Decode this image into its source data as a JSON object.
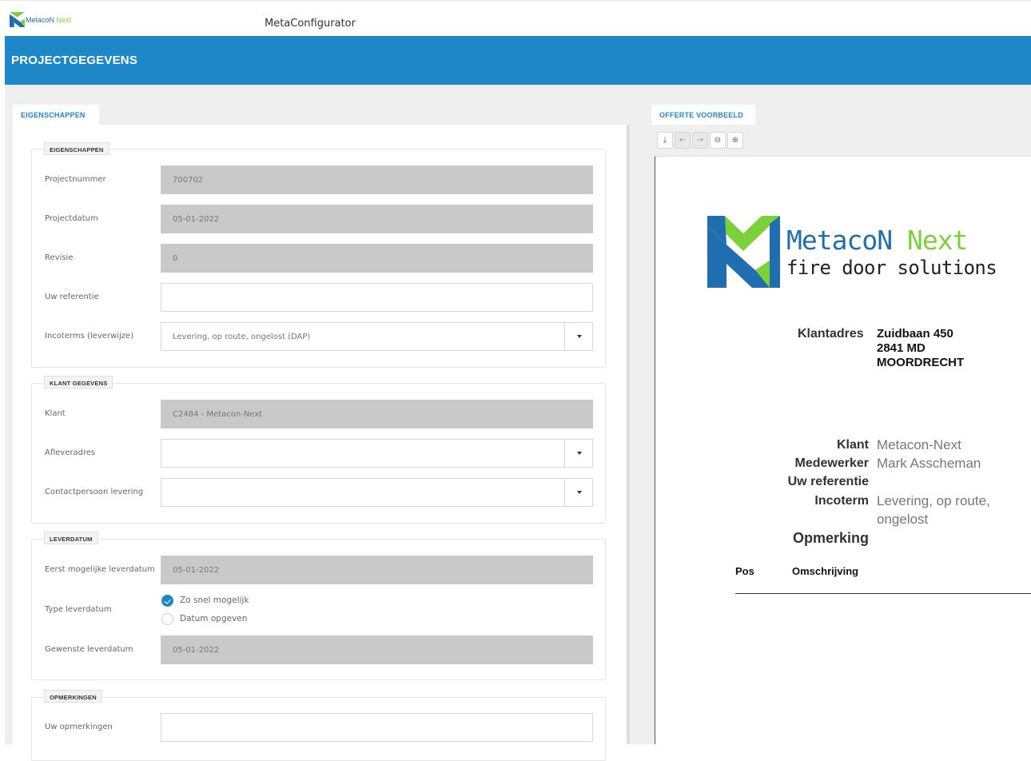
{
  "topbar": {
    "logo_word1": "MetacoN",
    "logo_word2": "Next",
    "app_title": "MetaConfigurator"
  },
  "header": {
    "title": "PROJECTGEGEVENS"
  },
  "tabs": {
    "left": "EIGENSCHAPPEN",
    "right": "OFFERTE VOORBEELD"
  },
  "sections": {
    "eigenschappen": {
      "legend": "EIGENSCHAPPEN",
      "fields": {
        "projectnummer": {
          "label": "Projectnummer",
          "value": "700702"
        },
        "projectdatum": {
          "label": "Projectdatum",
          "value": "05-01-2022"
        },
        "revisie": {
          "label": "Revisie",
          "value": "0"
        },
        "uw_referentie": {
          "label": "Uw referentie",
          "value": ""
        },
        "incoterms": {
          "label": "Incoterms (leverwijze)",
          "value": "Levering, op route, ongelost (DAP)"
        }
      }
    },
    "klant": {
      "legend": "KLANT GEGEVENS",
      "fields": {
        "klant": {
          "label": "Klant",
          "value": "C2484 - Metacon-Next"
        },
        "afleveradres": {
          "label": "Afleveradres",
          "value": ""
        },
        "contactpersoon": {
          "label": "Contactpersoon levering",
          "value": ""
        }
      }
    },
    "leverdatum": {
      "legend": "LEVERDATUM",
      "fields": {
        "eerst_mogelijk": {
          "label": "Eerst mogelijke leverdatum",
          "value": "05-01-2022"
        },
        "type": {
          "label": "Type leverdatum",
          "options": [
            "Zo snel mogelijk",
            "Datum opgeven"
          ],
          "selected": "Zo snel mogelijk"
        },
        "gewenst": {
          "label": "Gewenste leverdatum",
          "value": "05-01-2022"
        }
      }
    },
    "opmerkingen": {
      "legend": "OPMERKINGEN",
      "fields": {
        "uw_opmerkingen": {
          "label": "Uw opmerkingen",
          "value": ""
        }
      }
    }
  },
  "toolbar": {
    "buttons": [
      {
        "name": "download-icon",
        "glyph": "⤓",
        "enabled": true
      },
      {
        "name": "arrow-left-icon",
        "glyph": "←",
        "enabled": false
      },
      {
        "name": "arrow-right-icon",
        "glyph": "→",
        "enabled": false
      },
      {
        "name": "zoom-out-icon",
        "glyph": "⊖",
        "enabled": true
      },
      {
        "name": "zoom-in-icon",
        "glyph": "⊕",
        "enabled": true
      }
    ]
  },
  "preview": {
    "brand": {
      "name1": "MetacoN",
      "name2": "Next",
      "tagline": "fire door solutions",
      "color_blue": "#1f6fb0",
      "color_green": "#7cd13a"
    },
    "klantadres_label": "Klantadres",
    "address": [
      "Zuidbaan 450",
      "2841 MD",
      "MOORDRECHT"
    ],
    "rows": {
      "klant": {
        "label": "Klant",
        "value": "Metacon-Next"
      },
      "medewerker": {
        "label": "Medewerker",
        "value": "Mark Asscheman"
      },
      "uw_referentie": {
        "label": "Uw referentie",
        "value": ""
      },
      "incoterm": {
        "label": "Incoterm",
        "value1": "Levering, op route,",
        "value2": "ongelost"
      },
      "opmerking": {
        "label": "Opmerking",
        "value": ""
      }
    },
    "table_headers": {
      "pos": "Pos",
      "omschrijving": "Omschrijving"
    }
  },
  "colors": {
    "accent": "#1e87c8",
    "readonly_field": "#c9c9c9"
  }
}
